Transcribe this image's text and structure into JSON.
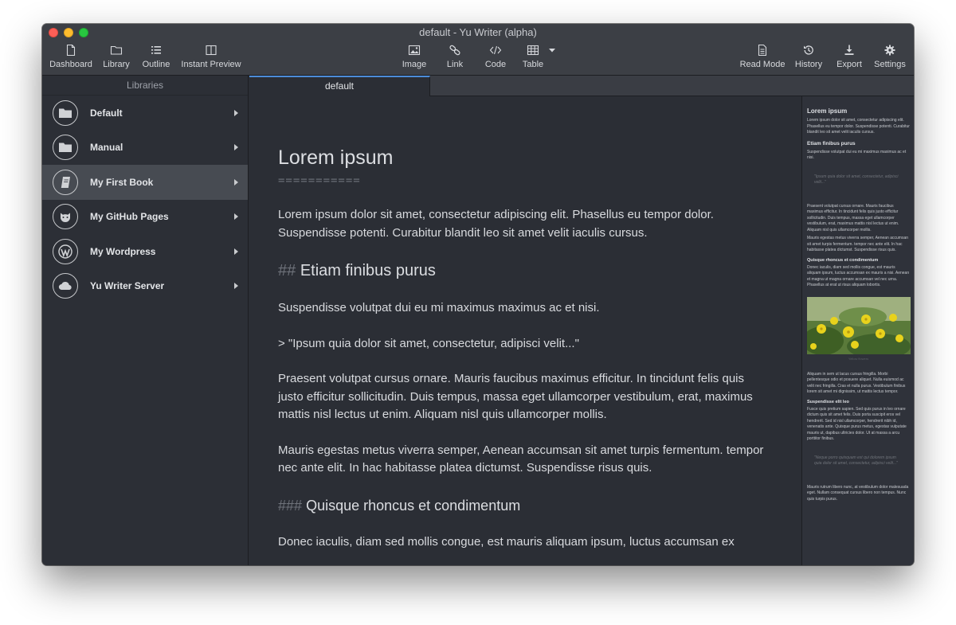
{
  "window": {
    "title": "default - Yu Writer (alpha)"
  },
  "toolbar": {
    "dashboard": "Dashboard",
    "library": "Library",
    "outline": "Outline",
    "instant_preview": "Instant Preview",
    "image": "Image",
    "link": "Link",
    "code": "Code",
    "table": "Table",
    "read_mode": "Read Mode",
    "history": "History",
    "export": "Export",
    "settings": "Settings"
  },
  "sidebar": {
    "header": "Libraries",
    "items": [
      {
        "label": "Default",
        "icon": "folder-icon"
      },
      {
        "label": "Manual",
        "icon": "folder-icon"
      },
      {
        "label": "My First Book",
        "icon": "book-icon",
        "active": true
      },
      {
        "label": "My GitHub Pages",
        "icon": "github-icon"
      },
      {
        "label": "My Wordpress",
        "icon": "wordpress-icon"
      },
      {
        "label": "Yu Writer Server",
        "icon": "cloud-icon"
      }
    ]
  },
  "tabs": [
    {
      "label": "default",
      "active": true
    }
  ],
  "editor": {
    "h1": "Lorem ipsum",
    "h1_underline": "===========",
    "p1": "Lorem ipsum dolor sit amet, consectetur adipiscing elit. Phasellus eu tempor dolor. Suspendisse potenti. Curabitur blandit leo sit amet velit iaculis cursus.",
    "h2_marker": "##",
    "h2": "Etiam finibus purus",
    "p2": "Suspendisse volutpat dui eu mi maximus maximus ac et nisi.",
    "quote": "> \"Ipsum quia dolor sit amet, consectetur, adipisci velit...\"",
    "p3": "Praesent volutpat cursus ornare. Mauris faucibus maximus efficitur. In tincidunt felis quis justo efficitur sollicitudin. Duis tempus, massa eget ullamcorper vestibulum, erat, maximus mattis nisl lectus ut enim. Aliquam nisl quis ullamcorper mollis.",
    "p4": "Mauris egestas metus viverra semper, Aenean accumsan sit amet turpis fermentum. tempor nec ante elit. In hac habitasse platea dictumst. Suspendisse risus quis.",
    "h3_marker": "###",
    "h3": "Quisque rhoncus et condimentum",
    "p5": "Donec iaculis, diam sed mollis congue, est mauris aliquam ipsum, luctus accumsan ex"
  },
  "preview": {
    "h1": "Lorem ipsum",
    "p1": "Lorem ipsum dolor sit amet, consectetur adipiscing elit. Phasellus eu tempor dolor. Suspendisse potenti. Curabitur blandit leo sit amet velit iaculis cursus.",
    "h2": "Etiam finibus purus",
    "p2": "Suspendisse volutpat dui eu mi maximus maximus ac et nisi.",
    "quote": "\"Ipsum quia dolor sit amet, consectetur, adipisci velit...\"",
    "p3": "Praesent volutpat cursus ornare. Mauris faucibus maximus efficitur. In tincidunt felis quis justo efficitur sollicitudin. Duis tempus, massa eget ullamcorper vestibulum, erat, maximus mattis nisl lectus ut enim. Aliquam nisl quis ullamcorper mollis.",
    "p4": "Mauris egestas metus viverra semper, Aenean accumsan sit amet turpis fermentum. tempor nec ante elit. In hac habitasse platea dictumst. Suspendisse risus quis.",
    "h3": "Quisque rhoncus et condimentum",
    "p5": "Donec iaculis, diam sed mollis congue, est mauris aliquam ipsum, luctus accumsan ex mauris a nisi. Aenean et magna ut magna ornare accumsan vel nec urna. Phasellus at erat ut risus aliquam lobortis.",
    "image_caption": "Yellow flowers",
    "p6": "Aliquam in sem ut lacus cursus fringilla. Morbi pellentesque odio et posuere aliquet. Nulla euismod ac velit nec fringilla. Cras et nulla purus. Vestibulum finibus lorem sit amet mi dignissim, ut mattis lectus tempor.",
    "h4": "Suspendisse elit leo",
    "p7": "Fusce quis pretium sapien. Sed quis purus in leo ornare dictum quis sit amet felis. Duis porta suscipit eros vel hendrerit. Sed id nisl ullamcorper, hendrerit nibh id, venenatis ante. Quisque purus metus, egestas vulputate mauris ut, dapibus ultricies dolor. Ut at massa a arcu porttitor finibus.",
    "quote2": "\"Neque porro quisquam est qui dolorem ipsum quia dolor sit amet, consectetur, adipisci velit...\"",
    "p8": "Mauris rutrum libero nunc, at vestibulum dolor malesuada eget. Nullam consequat cursus libero non tempus. Nunc quis turpis purus."
  },
  "colors": {
    "accent": "#4c8cd8",
    "window_bg": "#2b2e35",
    "toolbar_bg": "#3c3f45",
    "sidebar_active": "#474b52"
  }
}
